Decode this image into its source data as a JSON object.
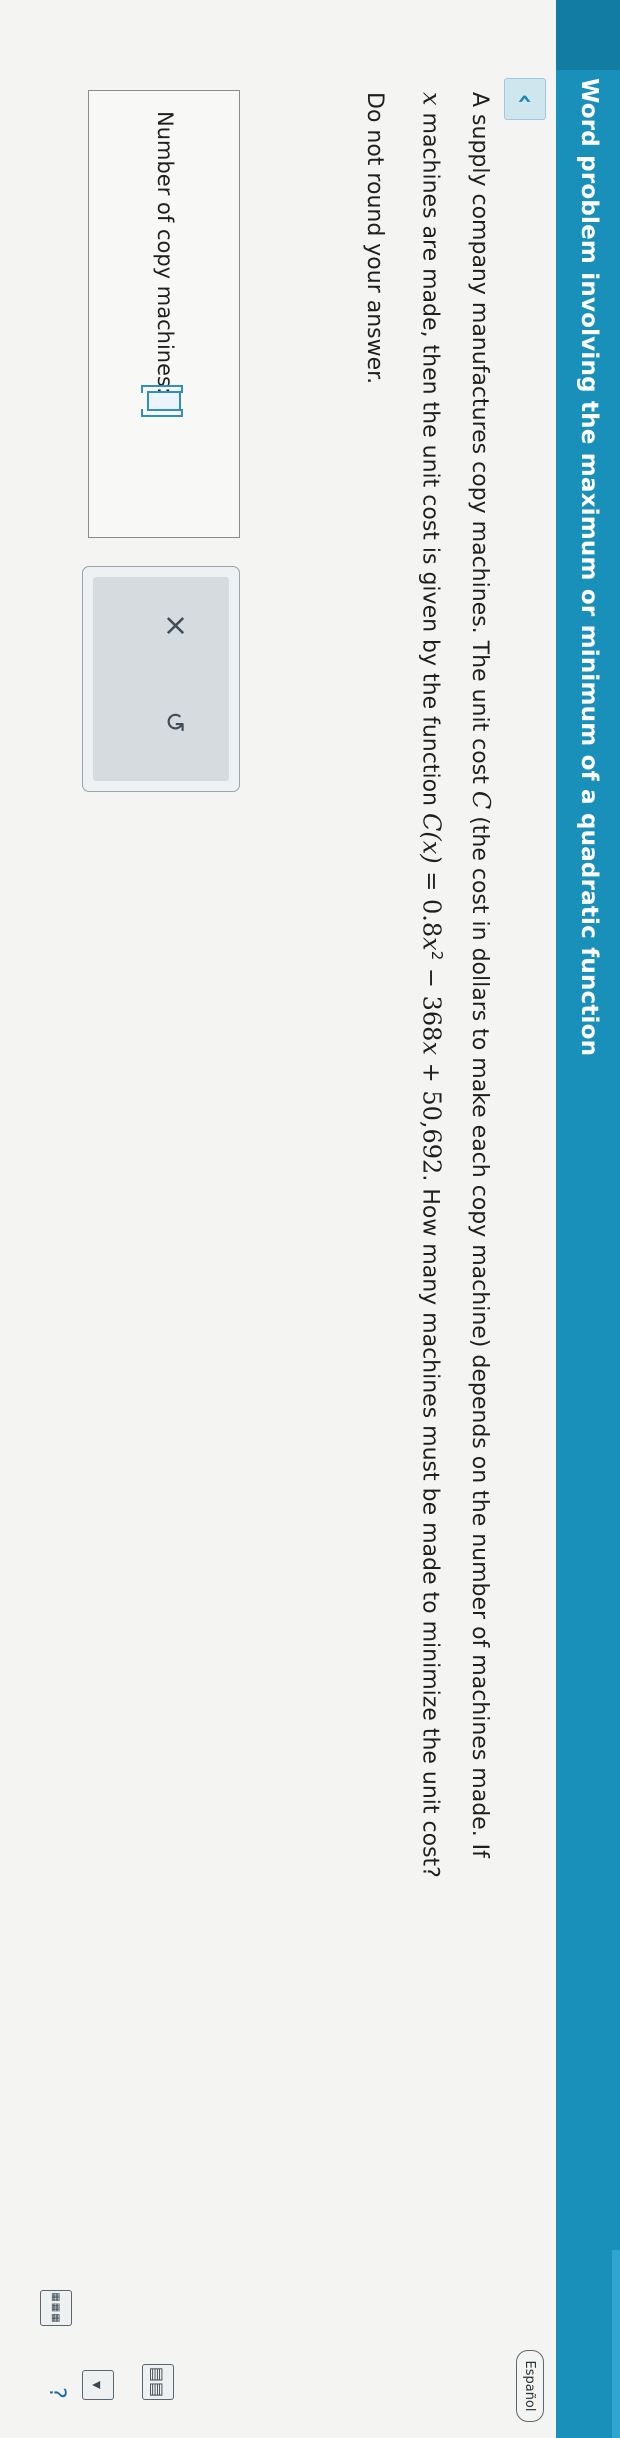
{
  "header": {
    "title": "Word problem involving the maximum or minimum of a quadratic function"
  },
  "language_button": "Español",
  "question": {
    "line1_a": "A supply company manufactures copy machines. The unit cost ",
    "var_C": "C",
    "line1_b": " (the cost in dollars to make each copy machine) depends on the number of machines made. If",
    "var_x": "x",
    "line2_a": " machines are made, then the unit cost is given by the function ",
    "func": "C(x)",
    "eq_a": " = 0.8",
    "eq_x2": "x",
    "eq_sup": "2",
    "eq_b": " − 368",
    "eq_x": "x",
    "eq_c": " + 50,692",
    "line2_b": ". How many machines must be made to minimize the unit cost?",
    "instruction": "Do not round your answer."
  },
  "answer": {
    "label": "Number of copy machines:",
    "value": ""
  },
  "actions": {
    "clear_symbol": "×",
    "undo_symbol": "↺"
  },
  "icons": {
    "back": "chevron-left-icon",
    "help": "?"
  }
}
